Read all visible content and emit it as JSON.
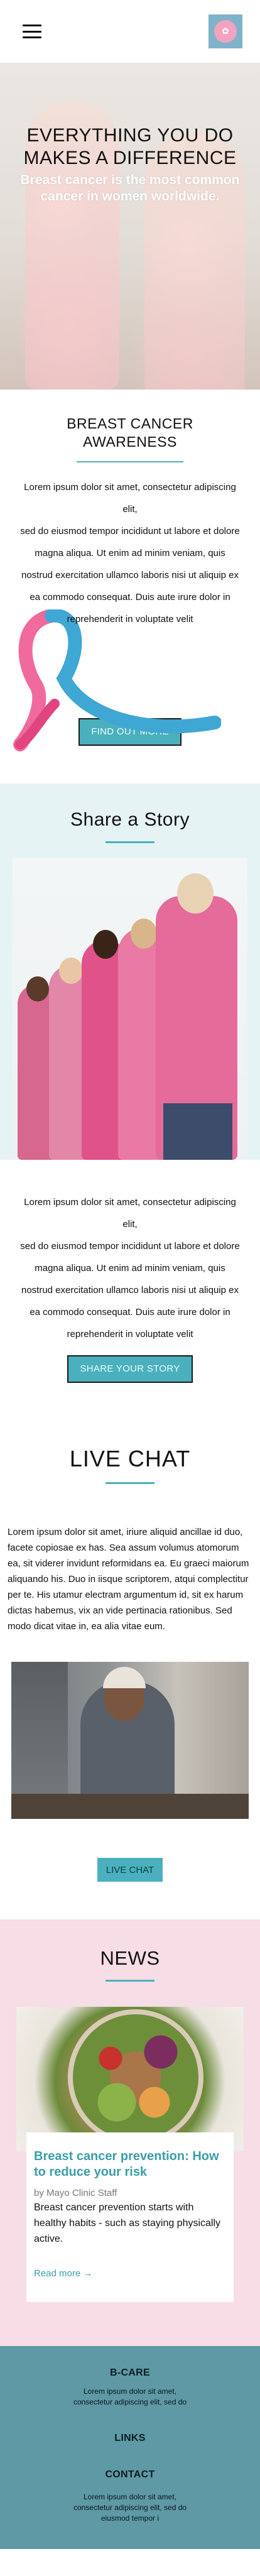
{
  "header": {
    "menu_icon": "hamburger-icon",
    "logo_icon": "b-care-logo"
  },
  "hero": {
    "title": "EVERYTHING YOU DO MAKES A DIFFERENCE",
    "subtitle": "Breast cancer is the most common cancer in women worldwide."
  },
  "about": {
    "title": "BREAST CANCER AWARENESS",
    "lines": [
      "Lorem ipsum dolor sit amet, consectetur adipiscing elit,",
      "sed do eiusmod tempor incididunt ut labore et dolore magna aliqua. Ut enim ad minim veniam, quis nostrud exercitation ullamco laboris nisi ut aliquip ex ea commodo consequat. Duis aute irure dolor in reprehenderit in voluptate velit"
    ],
    "button": "FIND OUT MORE",
    "ribbon_icon": "awareness-ribbon"
  },
  "story": {
    "title": "Share a Story",
    "lines": [
      "Lorem ipsum dolor sit amet, consectetur adipiscing elit,",
      "sed do eiusmod tempor incididunt ut labore et dolore magna aliqua. Ut enim ad minim veniam, quis nostrud exercitation ullamco laboris nisi ut aliquip ex ea commodo consequat. Duis aute irure dolor in reprehenderit in voluptate velit"
    ],
    "button": "SHARE YOUR STORY"
  },
  "live": {
    "title": "LIVE CHAT",
    "text": "Lorem ipsum dolor sit amet, iriure aliquid ancillae id duo, facete copiosae ex has. Sea assum volumus atomorum ea, sit viderer invidunt reformidans ea. Eu graeci maiorum aliquando his. Duo in iisque scriptorem, atqui complectitur per te. His utamur electram argumentum id, sit ex harum dictas habemus, vix an vide pertinacia rationibus. Sed modo dicat vitae in, ea alia vitae eum.",
    "button": "LIVE CHAT"
  },
  "news": {
    "title": "NEWS",
    "card": {
      "title": "Breast cancer prevention: How to reduce your risk",
      "byline": "by Mayo Clinic Staff",
      "text": "Breast cancer prevention starts with healthy habits - such as staying physically active.",
      "link": "Read more →"
    }
  },
  "footer": {
    "brand": "B-CARE",
    "brand_text": "Lorem ipsum dolor sit amet, consectetur adipiscing elit, sed do",
    "links": "LINKS",
    "contact": "CONTACT",
    "contact_text": "Lorem ipsum dolor sit amet, consectetur adipiscing elit, sed do eiusmod tempor i"
  },
  "colors": {
    "accent": "#4bb0be",
    "story_bg": "#e6f3f5",
    "news_bg": "#f7dde5",
    "footer_bg": "#5e99a5"
  }
}
